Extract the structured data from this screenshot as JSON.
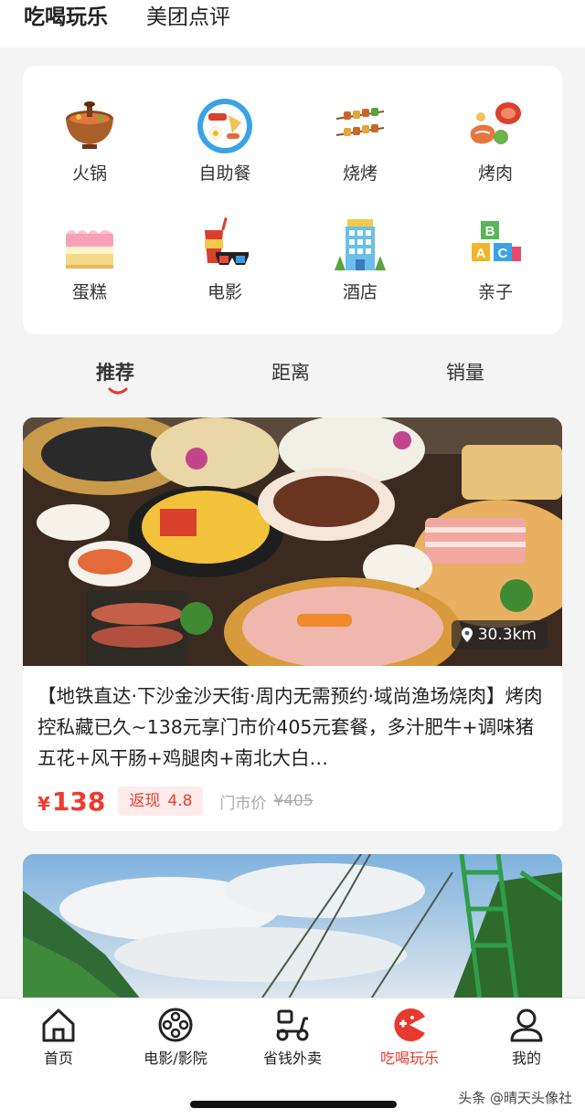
{
  "top_tabs": [
    {
      "label": "吃喝玩乐"
    },
    {
      "label": "美团点评"
    }
  ],
  "categories": [
    {
      "label": "火锅",
      "icon": "hotpot-icon"
    },
    {
      "label": "自助餐",
      "icon": "buffet-icon"
    },
    {
      "label": "烧烤",
      "icon": "bbq-skewer-icon"
    },
    {
      "label": "烤肉",
      "icon": "grilled-meat-icon"
    },
    {
      "label": "蛋糕",
      "icon": "cake-icon"
    },
    {
      "label": "电影",
      "icon": "movie-icon"
    },
    {
      "label": "酒店",
      "icon": "hotel-icon"
    },
    {
      "label": "亲子",
      "icon": "abc-blocks-icon"
    }
  ],
  "sort_tabs": [
    {
      "label": "推荐"
    },
    {
      "label": "距离"
    },
    {
      "label": "销量"
    }
  ],
  "deal": {
    "distance": "30.3km",
    "title": "【地铁直达·下沙金沙天街·周内无需预约·域尚渔场烧肉】烤肉控私藏已久~138元享门市价405元套餐，多汁肥牛+调味猪五花+风干肠+鸡腿肉+南北大白…",
    "currency": "¥",
    "price": "138",
    "cashback_label": "返现",
    "cashback_value": "4.8",
    "original_label": "门市价",
    "original_price": "¥405"
  },
  "bottom_nav": [
    {
      "label": "首页",
      "icon": "home-icon"
    },
    {
      "label": "电影/影院",
      "icon": "film-reel-icon"
    },
    {
      "label": "省钱外卖",
      "icon": "scooter-icon"
    },
    {
      "label": "吃喝玩乐",
      "icon": "pacman-icon"
    },
    {
      "label": "我的",
      "icon": "user-icon"
    }
  ],
  "watermark": "头条 @晴天头像社",
  "colors": {
    "accent": "#e8392e",
    "highlight": "#ffcf2e"
  }
}
